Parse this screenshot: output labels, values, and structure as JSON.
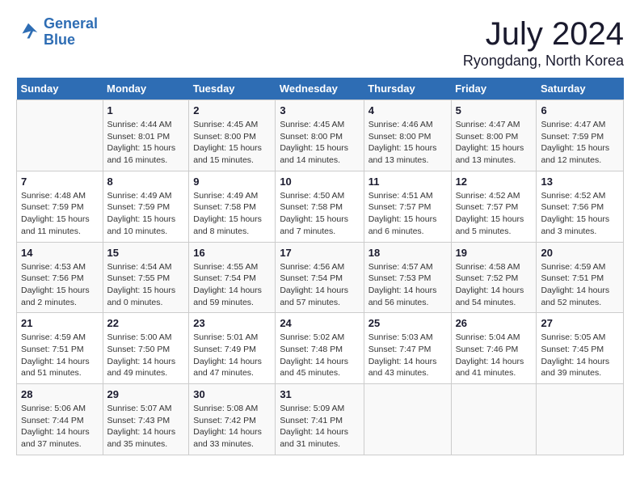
{
  "header": {
    "logo_line1": "General",
    "logo_line2": "Blue",
    "month": "July 2024",
    "location": "Ryongdang, North Korea"
  },
  "days_of_week": [
    "Sunday",
    "Monday",
    "Tuesday",
    "Wednesday",
    "Thursday",
    "Friday",
    "Saturday"
  ],
  "weeks": [
    [
      {
        "day": "",
        "info": ""
      },
      {
        "day": "1",
        "info": "Sunrise: 4:44 AM\nSunset: 8:01 PM\nDaylight: 15 hours\nand 16 minutes."
      },
      {
        "day": "2",
        "info": "Sunrise: 4:45 AM\nSunset: 8:00 PM\nDaylight: 15 hours\nand 15 minutes."
      },
      {
        "day": "3",
        "info": "Sunrise: 4:45 AM\nSunset: 8:00 PM\nDaylight: 15 hours\nand 14 minutes."
      },
      {
        "day": "4",
        "info": "Sunrise: 4:46 AM\nSunset: 8:00 PM\nDaylight: 15 hours\nand 13 minutes."
      },
      {
        "day": "5",
        "info": "Sunrise: 4:47 AM\nSunset: 8:00 PM\nDaylight: 15 hours\nand 13 minutes."
      },
      {
        "day": "6",
        "info": "Sunrise: 4:47 AM\nSunset: 7:59 PM\nDaylight: 15 hours\nand 12 minutes."
      }
    ],
    [
      {
        "day": "7",
        "info": "Sunrise: 4:48 AM\nSunset: 7:59 PM\nDaylight: 15 hours\nand 11 minutes."
      },
      {
        "day": "8",
        "info": "Sunrise: 4:49 AM\nSunset: 7:59 PM\nDaylight: 15 hours\nand 10 minutes."
      },
      {
        "day": "9",
        "info": "Sunrise: 4:49 AM\nSunset: 7:58 PM\nDaylight: 15 hours\nand 8 minutes."
      },
      {
        "day": "10",
        "info": "Sunrise: 4:50 AM\nSunset: 7:58 PM\nDaylight: 15 hours\nand 7 minutes."
      },
      {
        "day": "11",
        "info": "Sunrise: 4:51 AM\nSunset: 7:57 PM\nDaylight: 15 hours\nand 6 minutes."
      },
      {
        "day": "12",
        "info": "Sunrise: 4:52 AM\nSunset: 7:57 PM\nDaylight: 15 hours\nand 5 minutes."
      },
      {
        "day": "13",
        "info": "Sunrise: 4:52 AM\nSunset: 7:56 PM\nDaylight: 15 hours\nand 3 minutes."
      }
    ],
    [
      {
        "day": "14",
        "info": "Sunrise: 4:53 AM\nSunset: 7:56 PM\nDaylight: 15 hours\nand 2 minutes."
      },
      {
        "day": "15",
        "info": "Sunrise: 4:54 AM\nSunset: 7:55 PM\nDaylight: 15 hours\nand 0 minutes."
      },
      {
        "day": "16",
        "info": "Sunrise: 4:55 AM\nSunset: 7:54 PM\nDaylight: 14 hours\nand 59 minutes."
      },
      {
        "day": "17",
        "info": "Sunrise: 4:56 AM\nSunset: 7:54 PM\nDaylight: 14 hours\nand 57 minutes."
      },
      {
        "day": "18",
        "info": "Sunrise: 4:57 AM\nSunset: 7:53 PM\nDaylight: 14 hours\nand 56 minutes."
      },
      {
        "day": "19",
        "info": "Sunrise: 4:58 AM\nSunset: 7:52 PM\nDaylight: 14 hours\nand 54 minutes."
      },
      {
        "day": "20",
        "info": "Sunrise: 4:59 AM\nSunset: 7:51 PM\nDaylight: 14 hours\nand 52 minutes."
      }
    ],
    [
      {
        "day": "21",
        "info": "Sunrise: 4:59 AM\nSunset: 7:51 PM\nDaylight: 14 hours\nand 51 minutes."
      },
      {
        "day": "22",
        "info": "Sunrise: 5:00 AM\nSunset: 7:50 PM\nDaylight: 14 hours\nand 49 minutes."
      },
      {
        "day": "23",
        "info": "Sunrise: 5:01 AM\nSunset: 7:49 PM\nDaylight: 14 hours\nand 47 minutes."
      },
      {
        "day": "24",
        "info": "Sunrise: 5:02 AM\nSunset: 7:48 PM\nDaylight: 14 hours\nand 45 minutes."
      },
      {
        "day": "25",
        "info": "Sunrise: 5:03 AM\nSunset: 7:47 PM\nDaylight: 14 hours\nand 43 minutes."
      },
      {
        "day": "26",
        "info": "Sunrise: 5:04 AM\nSunset: 7:46 PM\nDaylight: 14 hours\nand 41 minutes."
      },
      {
        "day": "27",
        "info": "Sunrise: 5:05 AM\nSunset: 7:45 PM\nDaylight: 14 hours\nand 39 minutes."
      }
    ],
    [
      {
        "day": "28",
        "info": "Sunrise: 5:06 AM\nSunset: 7:44 PM\nDaylight: 14 hours\nand 37 minutes."
      },
      {
        "day": "29",
        "info": "Sunrise: 5:07 AM\nSunset: 7:43 PM\nDaylight: 14 hours\nand 35 minutes."
      },
      {
        "day": "30",
        "info": "Sunrise: 5:08 AM\nSunset: 7:42 PM\nDaylight: 14 hours\nand 33 minutes."
      },
      {
        "day": "31",
        "info": "Sunrise: 5:09 AM\nSunset: 7:41 PM\nDaylight: 14 hours\nand 31 minutes."
      },
      {
        "day": "",
        "info": ""
      },
      {
        "day": "",
        "info": ""
      },
      {
        "day": "",
        "info": ""
      }
    ]
  ]
}
